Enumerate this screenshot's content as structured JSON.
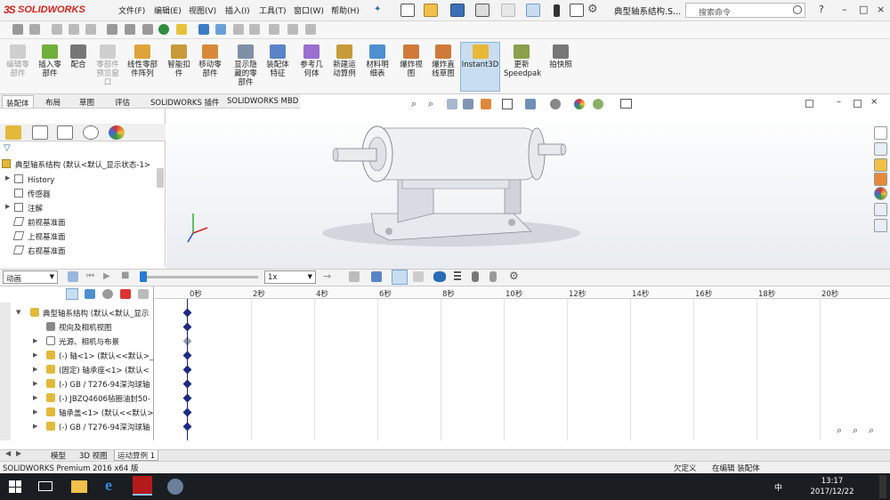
{
  "titlebar": {
    "brand_ds": "3S",
    "brand_name": "SOLIDWORKS",
    "menus": [
      "文件(F)",
      "编辑(E)",
      "视图(V)",
      "插入(I)",
      "工具(T)",
      "窗口(W)",
      "帮助(H)"
    ],
    "doc_name": "典型轴系结构.S...",
    "search_placeholder": "搜索命令",
    "help_label": "?",
    "window_buttons": [
      "–",
      "□",
      "×"
    ]
  },
  "ribbon": {
    "buttons": [
      {
        "label": "编辑零\n部件",
        "disabled": true,
        "color": "#cfcfcf"
      },
      {
        "label": "插入零\n部件",
        "disabled": false,
        "color": "#6fb03a"
      },
      {
        "label": "配合",
        "disabled": false,
        "color": "#777777"
      },
      {
        "label": "零部件\n预览窗\n口",
        "disabled": true,
        "color": "#cfcfcf"
      },
      {
        "label": "线性零部\n件阵列",
        "disabled": false,
        "color": "#e0a23a"
      },
      {
        "label": "智能扣\n件",
        "disabled": false,
        "color": "#c99a3a"
      },
      {
        "label": "移动零\n部件",
        "disabled": false,
        "color": "#d88a3a"
      },
      {
        "label": "显示隐\n藏的零\n部件",
        "disabled": false,
        "color": "#7f8fa6"
      },
      {
        "label": "装配体\n特征",
        "disabled": false,
        "color": "#5a84c7"
      },
      {
        "label": "参考几\n何体",
        "disabled": false,
        "color": "#9a6fd0"
      },
      {
        "label": "新建运\n动算例",
        "disabled": false,
        "color": "#c79b3a"
      },
      {
        "label": "材料明\n细表",
        "disabled": false,
        "color": "#4e8fd0"
      },
      {
        "label": "爆炸视\n图",
        "disabled": false,
        "color": "#cf7a3a"
      },
      {
        "label": "爆炸直\n线草图",
        "disabled": false,
        "color": "#cf7a3a"
      },
      {
        "label": "Instant3D",
        "disabled": false,
        "color": "#e8b83a"
      },
      {
        "label": "更新\nSpeedpak",
        "disabled": false,
        "color": "#8aa04a"
      },
      {
        "label": "拍快照",
        "disabled": false,
        "color": "#777777"
      }
    ]
  },
  "tabs": [
    "装配体",
    "布局",
    "草图",
    "评估",
    "SOLIDWORKS 插件",
    "SOLIDWORKS MBD"
  ],
  "feature_tree": {
    "root": "典型轴系结构 (默认<默认_显示状态-1>",
    "items": [
      "History",
      "传感器",
      "注解",
      "前视基准面",
      "上视基准面",
      "右视基准面"
    ]
  },
  "motion": {
    "study_type": "动画",
    "speed": "1x",
    "ruler": [
      "0秒",
      "2秒",
      "4秒",
      "6秒",
      "8秒",
      "10秒",
      "12秒",
      "14秒",
      "16秒",
      "18秒",
      "20秒"
    ],
    "rows": [
      "典型轴系结构 (默认<默认_显示",
      "视向及相机视图",
      "光源、相机与布景",
      "(-) 轴<1> (默认<<默认>_",
      "(固定) 轴承座<1> (默认<",
      "(-) GB / T276-94深沟球轴",
      "(-) JBZQ4606毡圈油封50-",
      "轴承盖<1> (默认<<默认>",
      "(-) GB / T276-94深沟球轴"
    ]
  },
  "bottom_tabs": [
    "模型",
    "3D 视图",
    "运动算例 1"
  ],
  "status": {
    "product": "SOLIDWORKS Premium 2016 x64 版",
    "right_text": "欠定义",
    "edit_text": "在编辑 装配体"
  },
  "taskbar": {
    "time": "13:17",
    "date": "2017/12/22",
    "ime": "中"
  },
  "colors": {
    "brand_red": "#d7251f",
    "selected_blue": "#c8ddf0",
    "key_color": "#1d2a80",
    "taskbar": "#1a1d22"
  }
}
